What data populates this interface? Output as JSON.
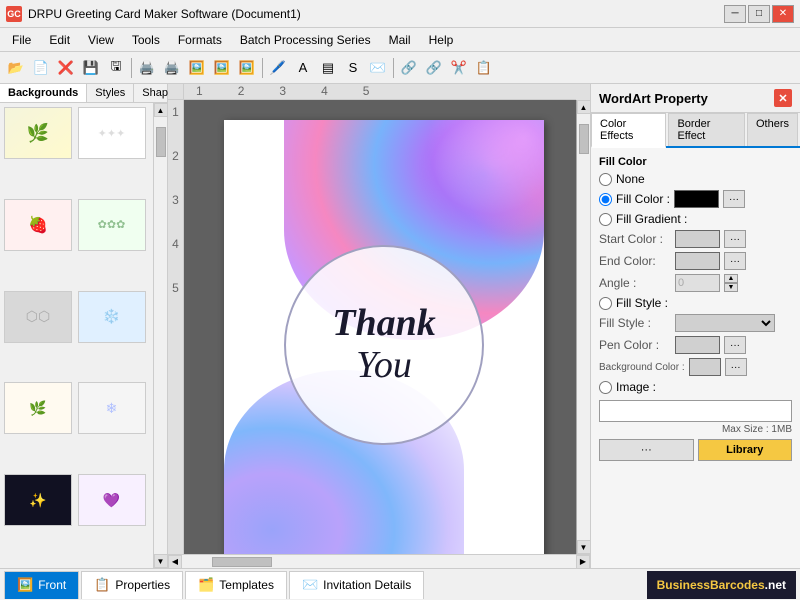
{
  "titleBar": {
    "icon": "GC",
    "title": "DRPU Greeting Card Maker Software (Document1)",
    "controls": [
      "minimize",
      "maximize",
      "close"
    ]
  },
  "menuBar": {
    "items": [
      "File",
      "Edit",
      "View",
      "Tools",
      "Formats",
      "Batch Processing Series",
      "Mail",
      "Help"
    ]
  },
  "toolbar": {
    "buttons": [
      "📁",
      "💾",
      "❌",
      "🖫",
      "📋",
      "✂️",
      "📄",
      "🖨️",
      "📄",
      "🔳",
      "🖊️",
      "🔗",
      "A",
      "S",
      "✉️",
      "📐"
    ]
  },
  "leftPanel": {
    "tabs": [
      "Backgrounds",
      "Styles",
      "Shapes"
    ],
    "activeTab": "Backgrounds",
    "thumbnails": [
      {
        "id": 1,
        "pattern": "bg-pattern-1"
      },
      {
        "id": 2,
        "pattern": "bg-pattern-2"
      },
      {
        "id": 3,
        "pattern": "bg-pattern-3"
      },
      {
        "id": 4,
        "pattern": "bg-pattern-4"
      },
      {
        "id": 5,
        "pattern": "bg-pattern-5"
      },
      {
        "id": 6,
        "pattern": "bg-pattern-6"
      },
      {
        "id": 7,
        "pattern": "bg-pattern-7"
      },
      {
        "id": 8,
        "pattern": "bg-pattern-8"
      },
      {
        "id": 9,
        "pattern": "bg-pattern-9"
      },
      {
        "id": 10,
        "pattern": "bg-pattern-10"
      }
    ]
  },
  "card": {
    "thankText": "Thank",
    "youText": "You"
  },
  "wordArtPanel": {
    "title": "WordArt Property",
    "tabs": [
      "Color Effects",
      "Border Effect",
      "Others"
    ],
    "activeTab": "Color Effects",
    "fillColor": {
      "sectionLabel": "Fill Color",
      "options": [
        "None",
        "Fill Color :",
        "Fill Gradient :"
      ],
      "selectedOption": "Fill Color :",
      "colorValue": "#000000"
    },
    "fillGradient": {
      "startColor": "Start Color :",
      "endColor": "End Color:",
      "angle": "Angle :",
      "angleValue": "0"
    },
    "fillStyle": {
      "label": "Fill Style :",
      "styleLabel": "Fill Style :"
    },
    "penColor": {
      "label": "Pen Color :"
    },
    "backgroundColor": {
      "label": "Background Color :"
    },
    "image": {
      "label": "Image :",
      "maxSize": "Max Size : 1MB"
    },
    "buttons": {
      "library": "Library",
      "plain": "..."
    }
  },
  "statusBar": {
    "tabs": [
      "Front",
      "Properties",
      "Templates",
      "Invitation Details"
    ],
    "activeTab": "Front",
    "brand": {
      "text": "BusinessBarcodes",
      "suffix": ".net"
    }
  }
}
